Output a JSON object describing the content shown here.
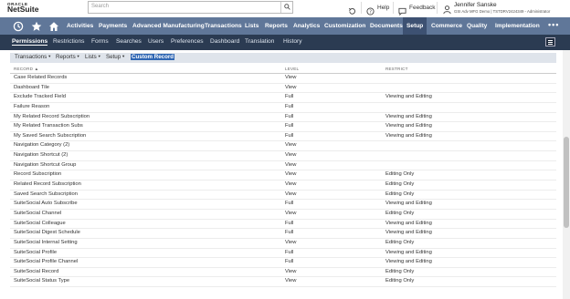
{
  "header": {
    "logo_top": "ORACLE",
    "logo_bottom": "NetSuite",
    "search_placeholder": "Search",
    "help_label": "Help",
    "feedback_label": "Feedback",
    "user_name": "Jennifer Sanske",
    "user_account": "GSI Adv MFG Demo  |  TSTDRV2424349 - Administrator"
  },
  "nav": {
    "items": [
      {
        "label": "Activities",
        "active": false
      },
      {
        "label": "Payments",
        "active": false
      },
      {
        "label": "Advanced Manufacturing",
        "active": false
      },
      {
        "label": "Transactions",
        "active": false
      },
      {
        "label": "Lists",
        "active": false
      },
      {
        "label": "Reports",
        "active": false
      },
      {
        "label": "Analytics",
        "active": false
      },
      {
        "label": "Customization",
        "active": false
      },
      {
        "label": "Documents",
        "active": false
      },
      {
        "label": "Setup",
        "active": true
      },
      {
        "label": "Commerce",
        "active": false
      },
      {
        "label": "Quality",
        "active": false
      },
      {
        "label": "Implementation",
        "active": false
      }
    ],
    "more": "•••"
  },
  "subnav": {
    "items": [
      "Permissions",
      "Restrictions",
      "Forms",
      "Searches",
      "Users",
      "Preferences",
      "Dashboard",
      "Translation",
      "History"
    ],
    "active_index": 0
  },
  "toolbar": {
    "items": [
      "Transactions",
      "Reports",
      "Lists",
      "Setup"
    ],
    "selected": "Custom Record"
  },
  "table": {
    "headers": {
      "record": "RECORD ▲",
      "level": "LEVEL",
      "restrict": "RESTRICT"
    },
    "rows": [
      {
        "record": "Case Related Records",
        "level": "View",
        "restrict": ""
      },
      {
        "record": "Dashboard Tile",
        "level": "View",
        "restrict": ""
      },
      {
        "record": "Exclude Tracked Field",
        "level": "Full",
        "restrict": "Viewing and Editing"
      },
      {
        "record": "Failure Reason",
        "level": "Full",
        "restrict": ""
      },
      {
        "record": "My Related Record Subscription",
        "level": "Full",
        "restrict": "Viewing and Editing"
      },
      {
        "record": "My Related Transaction Subs",
        "level": "Full",
        "restrict": "Viewing and Editing"
      },
      {
        "record": "My Saved Search Subscription",
        "level": "Full",
        "restrict": "Viewing and Editing"
      },
      {
        "record": "Navigation Category (2)",
        "level": "View",
        "restrict": ""
      },
      {
        "record": "Navigation Shortcut (2)",
        "level": "View",
        "restrict": ""
      },
      {
        "record": "Navigation Shortcut Group",
        "level": "View",
        "restrict": ""
      },
      {
        "record": "Record Subscription",
        "level": "View",
        "restrict": "Editing Only"
      },
      {
        "record": "Related Record Subscription",
        "level": "View",
        "restrict": "Editing Only"
      },
      {
        "record": "Saved Search Subscription",
        "level": "View",
        "restrict": "Editing Only"
      },
      {
        "record": "SuiteSocial Auto Subscribe",
        "level": "Full",
        "restrict": "Viewing and Editing"
      },
      {
        "record": "SuiteSocial Channel",
        "level": "View",
        "restrict": "Editing Only"
      },
      {
        "record": "SuiteSocial Colleague",
        "level": "Full",
        "restrict": "Viewing and Editing"
      },
      {
        "record": "SuiteSocial Digest Schedule",
        "level": "Full",
        "restrict": "Viewing and Editing"
      },
      {
        "record": "SuiteSocial Internal Setting",
        "level": "View",
        "restrict": "Editing Only"
      },
      {
        "record": "SuiteSocial Profile",
        "level": "Full",
        "restrict": "Viewing and Editing"
      },
      {
        "record": "SuiteSocial Profile Channel",
        "level": "Full",
        "restrict": "Viewing and Editing"
      },
      {
        "record": "SuiteSocial Record",
        "level": "View",
        "restrict": "Editing Only"
      },
      {
        "record": "SuiteSocial Status Type",
        "level": "View",
        "restrict": "Editing Only"
      }
    ]
  },
  "colors": {
    "nav_bg": "#607799",
    "nav_active": "#3d5172",
    "subnav_bg": "#2b3b52",
    "selection": "#2f66b3"
  }
}
